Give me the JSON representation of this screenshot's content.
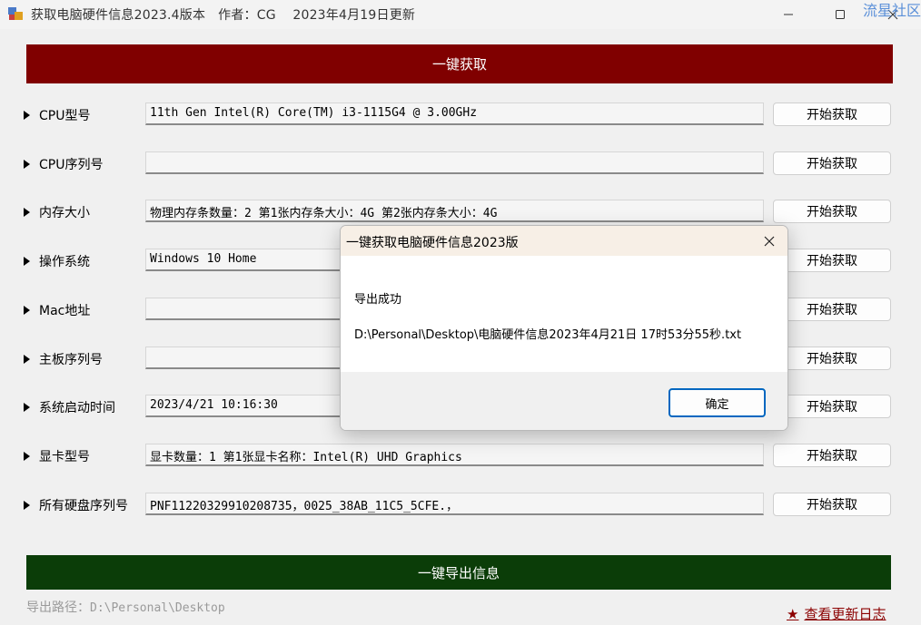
{
  "window": {
    "title": "获取电脑硬件信息2023.4版本   作者：CG    2023年4月19日更新",
    "overlay_text": "流星社区"
  },
  "toolbar": {
    "get_all_label": "一键获取"
  },
  "rows": [
    {
      "label": "CPU型号",
      "value": "11th Gen Intel(R) Core(TM) i3-1115G4 @ 3.00GHz",
      "button": "开始获取"
    },
    {
      "label": "CPU序列号",
      "value": "",
      "button": "开始获取"
    },
    {
      "label": "内存大小",
      "value": "物理内存条数量：2  第1张内存条大小：4G   第2张内存条大小：4G",
      "button": "开始获取"
    },
    {
      "label": "操作系统",
      "value": "Windows 10 Home",
      "button": "开始获取"
    },
    {
      "label": "Mac地址",
      "value": "",
      "button": "开始获取"
    },
    {
      "label": "主板序列号",
      "value": "",
      "button": "开始获取"
    },
    {
      "label": "系统启动时间",
      "value": "2023/4/21 10:16:30",
      "button": "开始获取"
    },
    {
      "label": "显卡型号",
      "value": "显卡数量：1  第1张显卡名称：Intel(R) UHD Graphics",
      "button": "开始获取"
    },
    {
      "label": "所有硬盘序列号",
      "value": "PNF11220329910208735，0025_38AB_11C5_5CFE.，",
      "button": "开始获取"
    }
  ],
  "footer": {
    "export_label": "一键导出信息",
    "export_path_label": "导出路径：",
    "export_path_value": "D:\\Personal\\Desktop",
    "changelog_label": "查看更新日志"
  },
  "dialog": {
    "title": "一键获取电脑硬件信息2023版",
    "message": "导出成功",
    "path": "D:\\Personal\\Desktop\\电脑硬件信息2023年4月21日 17时53分55秒.txt",
    "ok_label": "确定"
  },
  "colors": {
    "get_all_bg": "#800000",
    "export_bg": "#0b3d08",
    "changelog": "#8b0000",
    "dialog_accent": "#0067c0"
  }
}
